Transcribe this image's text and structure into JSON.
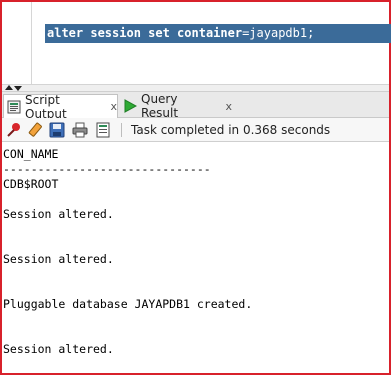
{
  "editor": {
    "code_keywords": "alter session set container",
    "code_rest": "=jayapdb1;"
  },
  "tabs": [
    {
      "label": "Script Output",
      "close": "x",
      "icon": "script-output-icon"
    },
    {
      "label": "Query Result",
      "close": "x",
      "icon": "run-arrow-icon"
    }
  ],
  "toolbar": {
    "status": "Task completed in 0.368 seconds",
    "icons": [
      "pin-icon",
      "eraser-icon",
      "save-icon",
      "print-icon",
      "open-file-icon"
    ]
  },
  "output": {
    "lines": [
      "CON_NAME",
      "------------------------------",
      "CDB$ROOT",
      "Session altered.",
      "Session altered.",
      "Pluggable database JAYAPDB1 created.",
      "Session altered."
    ]
  },
  "colors": {
    "selection": "#3b6b99",
    "frame": "#d8212b",
    "run_arrow": "#2eaa34"
  }
}
